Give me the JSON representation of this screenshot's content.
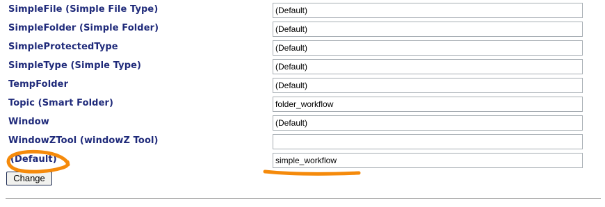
{
  "rows": [
    {
      "label": "SimpleFile (Simple File Type)",
      "value": "(Default)"
    },
    {
      "label": "SimpleFolder (Simple Folder)",
      "value": "(Default)"
    },
    {
      "label": "SimpleProtectedType",
      "value": "(Default)"
    },
    {
      "label": "SimpleType (Simple Type)",
      "value": "(Default)"
    },
    {
      "label": "TempFolder",
      "value": "(Default)"
    },
    {
      "label": "Topic (Smart Folder)",
      "value": "folder_workflow"
    },
    {
      "label": "Window",
      "value": "(Default)"
    },
    {
      "label": "WindowZTool (windowZ Tool)",
      "value": ""
    },
    {
      "label": "(Default)",
      "value": "simple_workflow"
    }
  ],
  "actions": {
    "change_label": "Change"
  },
  "annotation": {
    "color": "#f58a0b"
  }
}
